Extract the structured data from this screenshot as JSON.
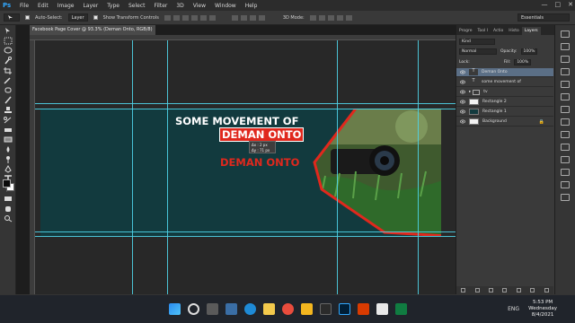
{
  "app": {
    "logo": "Ps"
  },
  "menu": [
    "File",
    "Edit",
    "Image",
    "Layer",
    "Type",
    "Select",
    "Filter",
    "3D",
    "View",
    "Window",
    "Help"
  ],
  "window_controls": [
    "—",
    "□",
    "✕"
  ],
  "options": {
    "auto_select_label": "Auto-Select:",
    "auto_select_value": "Layer",
    "transform_label": "Show Transform Controls",
    "mode_3d_label": "3D Mode:",
    "workspace": "Essentials"
  },
  "document": {
    "tab_title": "Facebook Page Cover @ 93.3% (Deman Onto, RGB/8)",
    "tab_close": "×",
    "zoom": "93.3%",
    "doc_size": "Doc: 718.6K/1021.3K"
  },
  "artboard": {
    "line1": "SOME MOVEMENT OF",
    "line2": "DEMAN ONTO",
    "line3": "DEMAN ONTO",
    "measure_x": "Δx : 2 px",
    "measure_y": "Δy : 71 px"
  },
  "panels": {
    "tabs": [
      "Progre",
      "Tool I",
      "Actio",
      "Histo",
      "Layers"
    ],
    "kind_label": "Kind",
    "blend_mode": "Normal",
    "opacity_label": "Opacity:",
    "opacity_value": "100%",
    "lock_label": "Lock:",
    "fill_label": "Fill:",
    "fill_value": "100%",
    "layers": [
      {
        "name": "Deman Onto",
        "type": "text",
        "selected": true
      },
      {
        "name": "some movement of",
        "type": "text",
        "selected": false
      },
      {
        "name": "tv",
        "type": "folder",
        "selected": false
      },
      {
        "name": "Rectangle 2",
        "type": "shape",
        "selected": false
      },
      {
        "name": "Rectangle 1",
        "type": "shape",
        "selected": false
      },
      {
        "name": "Background",
        "type": "background",
        "selected": false
      }
    ]
  },
  "taskbar": {
    "time": "5:53 PM",
    "day": "Wednesday",
    "date": "8/4/2021",
    "lang": "ENG"
  },
  "colors": {
    "cover_bg": "#123a3e",
    "accent_red": "#e0281d",
    "guide": "#4fd3e8",
    "layer_selected": "#5b6f86"
  }
}
